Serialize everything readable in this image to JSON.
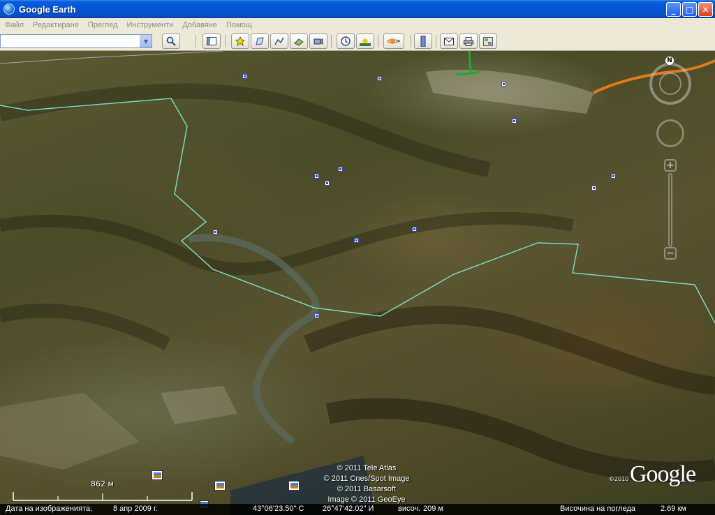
{
  "window": {
    "title": "Google Earth",
    "controls": {
      "minimize": "_",
      "maximize": "□",
      "close": "✕"
    }
  },
  "menu": {
    "items": [
      {
        "label": "Файл"
      },
      {
        "label": "Редактиране"
      },
      {
        "label": "Преглед"
      },
      {
        "label": "Инструменти"
      },
      {
        "label": "Добавяне"
      },
      {
        "label": "Помощ"
      }
    ]
  },
  "toolbar": {
    "search_value": "",
    "buttons": [
      "sidebar-icon",
      "placemark-icon",
      "polygon-icon",
      "path-icon",
      "image-overlay-icon",
      "record-tour-icon",
      "historical-imagery-icon",
      "sunlight-icon",
      "planets-icon",
      "ruler-icon",
      "email-icon",
      "print-icon",
      "google-maps-icon"
    ]
  },
  "map": {
    "attribution": [
      "© 2011 Tele Atlas",
      "© 2011 Cnes/Spot Image",
      "© 2011 Basarsoft",
      "Image © 2011 GeoEye"
    ],
    "google_year": "©2010",
    "google_logo": "Google",
    "scale_label": "862 м",
    "compass_north": "N"
  },
  "status": {
    "imagery_date_label": "Дата на изображенията:",
    "imagery_date": "8 апр 2009 г.",
    "latitude": "43°06'23.50\" С",
    "longitude": "26°47'42.02\" И",
    "elevation_label": "височ.",
    "elevation": "209 м",
    "eye_alt_label": "Височина на погледа",
    "eye_alt": "2.69 км"
  },
  "colors": {
    "border_line": "#7fe8d0",
    "road_orange": "#e07a1a",
    "road_green": "#1faa2a"
  }
}
